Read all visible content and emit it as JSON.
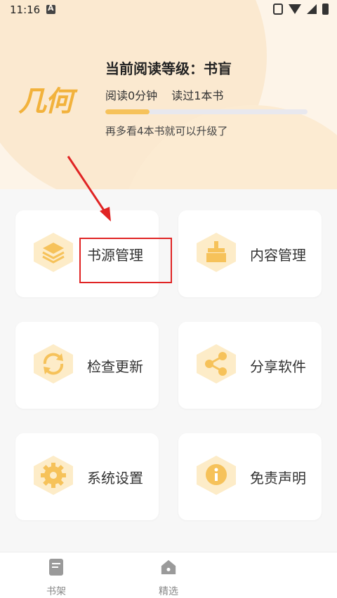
{
  "status_bar": {
    "time": "11:16"
  },
  "header": {
    "logo_text": "几何",
    "level_title": "当前阅读等级：书盲",
    "read_time": "阅读0分钟",
    "books_read": "读过1本书",
    "progress": 0.22,
    "hint": "再多看4本书就可以升级了"
  },
  "menu": {
    "items": [
      {
        "label": "书源管理",
        "icon": "layers-icon"
      },
      {
        "label": "内容管理",
        "icon": "broom-icon"
      },
      {
        "label": "检查更新",
        "icon": "refresh-icon"
      },
      {
        "label": "分享软件",
        "icon": "share-icon"
      },
      {
        "label": "系统设置",
        "icon": "gear-icon"
      },
      {
        "label": "免责声明",
        "icon": "info-icon"
      }
    ]
  },
  "bottom_nav": {
    "items": [
      {
        "label": "书架",
        "icon": "bookshelf-icon"
      },
      {
        "label": "精选",
        "icon": "home-icon"
      }
    ]
  },
  "colors": {
    "accent": "#f6c25a",
    "annotation": "#e02424"
  }
}
